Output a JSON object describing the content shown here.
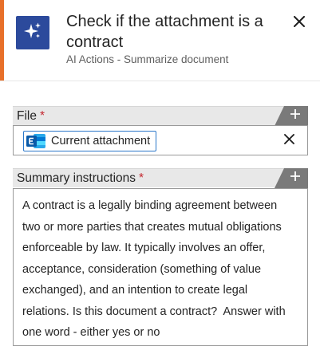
{
  "header": {
    "title": "Check if the attachment is a contract",
    "subtitle": "AI Actions - Summarize document",
    "accent_color": "#e8702a",
    "tile_color": "#2c4a9c",
    "tile_icon": "sparkle-icon",
    "close_icon": "close-icon"
  },
  "file_field": {
    "label": "File",
    "required_mark": "*",
    "add_icon": "plus-icon",
    "chip": {
      "icon": "exchange-icon",
      "label": "Current attachment"
    },
    "clear_icon": "close-icon"
  },
  "summary_field": {
    "label": "Summary instructions",
    "required_mark": "*",
    "add_icon": "plus-icon",
    "value": "A contract is a legally binding agreement between\ntwo or more parties that creates mutual obligations\nenforceable by law. It typically involves an offer,\nacceptance, consideration (something of value\nexchanged), and an intention to create legal\nrelations. Is this document a contract?  Answer with\none word - either yes or no"
  }
}
